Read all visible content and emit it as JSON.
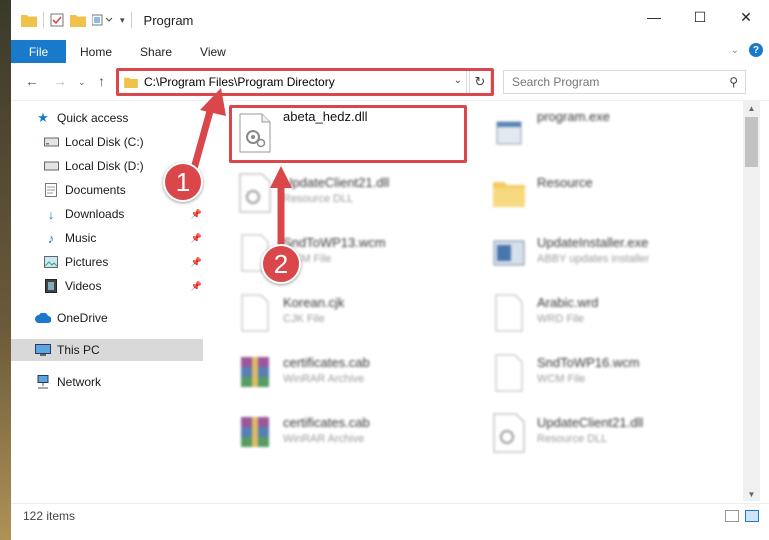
{
  "window": {
    "title": "Program"
  },
  "ribbon": {
    "tabs": [
      "File",
      "Home",
      "Share",
      "View"
    ],
    "help": "?"
  },
  "nav": {
    "address": "C:\\Program Files\\Program Directory",
    "search_placeholder": "Search Program"
  },
  "sidebar": {
    "items": [
      {
        "label": "Quick access",
        "icon": "star-icon"
      },
      {
        "label": "Local Disk (C:)",
        "icon": "drive-icon"
      },
      {
        "label": "Local Disk (D:)",
        "icon": "drive-icon"
      },
      {
        "label": "Documents",
        "icon": "documents-icon"
      },
      {
        "label": "Downloads",
        "icon": "download-icon"
      },
      {
        "label": "Music",
        "icon": "music-icon"
      },
      {
        "label": "Pictures",
        "icon": "pictures-icon"
      },
      {
        "label": "Videos",
        "icon": "videos-icon"
      },
      {
        "label": "OneDrive",
        "icon": "cloud-icon"
      },
      {
        "label": "This PC",
        "icon": "computer-icon"
      },
      {
        "label": "Network",
        "icon": "network-icon"
      }
    ]
  },
  "files": [
    {
      "name": "abeta_hedz.dll",
      "type": ""
    },
    {
      "name": "program.exe",
      "type": ""
    },
    {
      "name": "UpdateClient21.dll",
      "type": "Resource DLL"
    },
    {
      "name": "Resource",
      "type": ""
    },
    {
      "name": "SndToWP13.wcm",
      "type": "WCM File"
    },
    {
      "name": "UpdateInstaller.exe",
      "type": "ABBY updates installer"
    },
    {
      "name": "Korean.cjk",
      "type": "CJK File"
    },
    {
      "name": "Arabic.wrd",
      "type": "WRD File"
    },
    {
      "name": "certificates.cab",
      "type": "WinRAR Archive"
    },
    {
      "name": "SndToWP16.wcm",
      "type": "WCM File"
    },
    {
      "name": "certificates.cab",
      "type": "WinRAR Archive"
    },
    {
      "name": "UpdateClient21.dll",
      "type": "Resource DLL"
    }
  ],
  "status": {
    "count": "122 items"
  },
  "annotations": {
    "step1": "1",
    "step2": "2"
  },
  "colors": {
    "accent": "#1979ca",
    "highlight": "#d9474a"
  }
}
